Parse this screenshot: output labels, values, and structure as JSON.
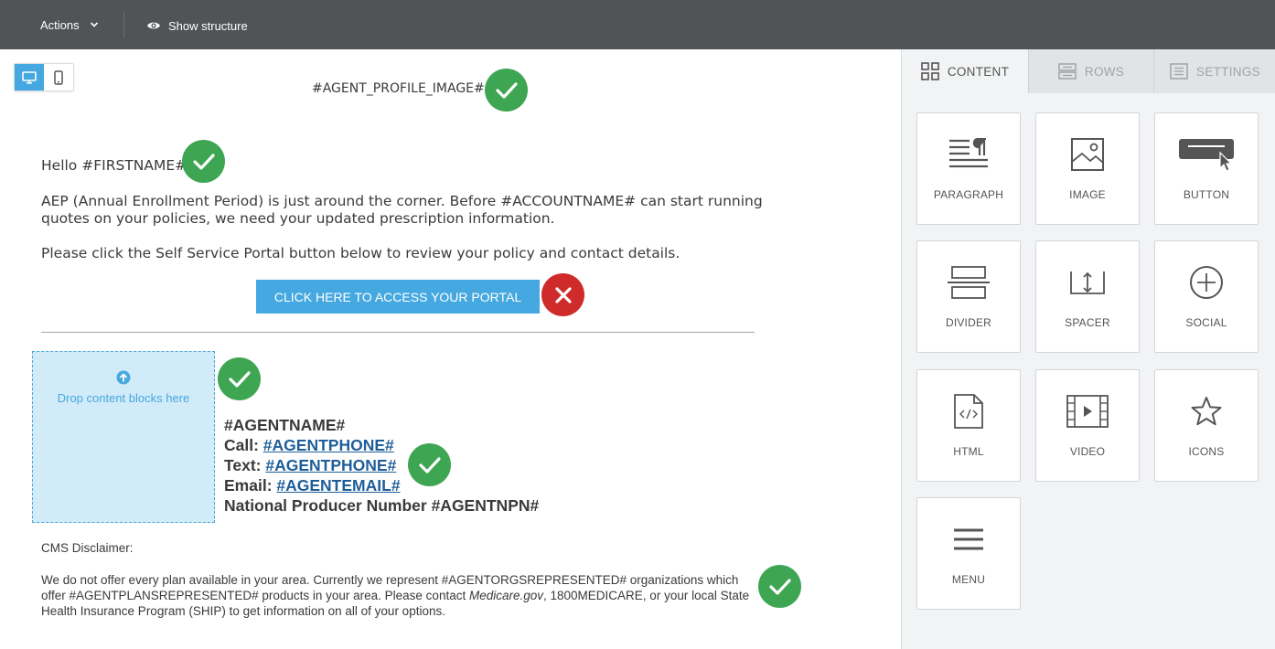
{
  "toolbar": {
    "actions_label": "Actions",
    "show_structure_label": "Show structure"
  },
  "email": {
    "profile_image": "#AGENT_PROFILE_IMAGE#",
    "greeting": "Hello #FIRSTNAME#",
    "paragraph1": "AEP (Annual Enrollment Period) is just around the corner. Before #ACCOUNTNAME# can start running quotes on your policies, we need your updated prescription information.",
    "paragraph2": "Please click the Self Service Portal button below to review your policy and contact details.",
    "portal_button": "CLICK HERE TO ACCESS YOUR PORTAL",
    "drop_placeholder": "Drop content blocks here",
    "agent": {
      "name": "#AGENTNAME#",
      "call_label": "Call: ",
      "call_value": "#AGENTPHONE# ",
      "text_label": "Text: ",
      "text_value": "#AGENTPHONE#",
      "email_label": "Email: ",
      "email_value": "#AGENTEMAIL#",
      "npn": "National Producer Number #AGENTNPN#"
    },
    "cms_title": "CMS Disclaimer:",
    "cms_part1": "We do not offer every plan available in your area. Currently we represent #AGENTORGSREPRESENTED#  organizations which offer #AGENTPLANSREPRESENTED#  products in your area. Please contact ",
    "cms_italic": "Medicare.gov",
    "cms_part2": ", 1800MEDICARE, or your local State Health Insurance Program (SHIP) to get information on all of your options."
  },
  "panel": {
    "tabs": [
      {
        "label": "CONTENT",
        "icon": "grid-icon",
        "active": true
      },
      {
        "label": "ROWS",
        "icon": "rows-icon",
        "active": false
      },
      {
        "label": "SETTINGS",
        "icon": "settings-icon",
        "active": false
      }
    ],
    "blocks": [
      {
        "label": "PARAGRAPH",
        "icon": "paragraph-icon"
      },
      {
        "label": "IMAGE",
        "icon": "image-icon"
      },
      {
        "label": "BUTTON",
        "icon": "button-icon"
      },
      {
        "label": "DIVIDER",
        "icon": "divider-icon"
      },
      {
        "label": "SPACER",
        "icon": "spacer-icon"
      },
      {
        "label": "SOCIAL",
        "icon": "social-icon"
      },
      {
        "label": "HTML",
        "icon": "html-icon"
      },
      {
        "label": "VIDEO",
        "icon": "video-icon"
      },
      {
        "label": "ICONS",
        "icon": "star-icon"
      },
      {
        "label": "MENU",
        "icon": "menu-icon"
      }
    ]
  },
  "colors": {
    "topbar": "#505457",
    "accent_blue": "#45a8e0",
    "check_green": "#3ea653",
    "error_red": "#cf2b2b",
    "link_blue": "#1e5e9a"
  }
}
